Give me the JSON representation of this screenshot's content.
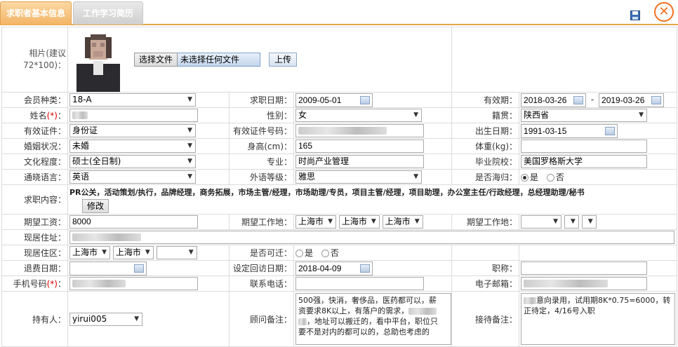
{
  "tabs": {
    "basic": "求职者基本信息",
    "resume": "工作学习简历"
  },
  "toolbar": {
    "close": "✕"
  },
  "photo": {
    "label": "相片(建议72*100)：",
    "choose_file": "选择文件",
    "no_file": "未选择任何文件",
    "upload": "上传"
  },
  "row1": {
    "member_type_label": "会员种类：",
    "member_type": "18-A",
    "job_date_label": "求职日期：",
    "job_date": "2009-05-01",
    "validity_label": "有效期：",
    "validity_from": "2018-03-26",
    "validity_sep": "-",
    "validity_to": "2019-03-26"
  },
  "row2": {
    "name_label": "姓名",
    "name_req": "(*)",
    "name_suffix": "：",
    "gender_label": "性别：",
    "gender": "女",
    "origin_label": "籍贯：",
    "origin": "陕西省"
  },
  "row3": {
    "id_type_label": "有效证件：",
    "id_type": "身份证",
    "id_no_label": "有效证件号码：",
    "birth_label": "出生日期：",
    "birth": "1991-03-15"
  },
  "row4": {
    "marital_label": "婚姻状况：",
    "marital": "未婚",
    "height_label": "身高(cm)：",
    "height": "165",
    "weight_label": "体重(kg)：",
    "weight": ""
  },
  "row5": {
    "edu_label": "文化程度：",
    "edu": "硕士(全日制)",
    "major_label": "专业：",
    "major": "时尚产业管理",
    "school_label": "毕业院校：",
    "school": "美国罗格斯大学"
  },
  "row6": {
    "lang_label": "通晓语言：",
    "lang": "英语",
    "foreign_label": "外语等级：",
    "foreign": "雅思",
    "returnee_label": "是否海归：",
    "yes": "是",
    "no": "否"
  },
  "row7": {
    "content_label": "求职内容：",
    "content": "PR公关，活动策划/执行，品牌经理，商务拓展，市场主管/经理，市场助理/专员，项目主管/经理，项目助理，办公室主任/行政经理，总经理助理/秘书",
    "modify": "修改"
  },
  "row8": {
    "salary_label": "期望工资：",
    "salary": "8000",
    "place_label": "期望工作地：",
    "place1": "上海市",
    "place2": "上海市",
    "place3": "上海市",
    "place2_label": "期望工作地："
  },
  "row9": {
    "address_label": "现居住址："
  },
  "row10": {
    "area_label": "现居住区：",
    "area1": "上海市",
    "area2": "上海市",
    "relocate_label": "是否可迁：",
    "yes": "是",
    "no": "否"
  },
  "row11": {
    "refund_label": "退费日期：",
    "visit_label": "设定回访日期：",
    "visit": "2018-04-09",
    "title_label": "职称："
  },
  "row12": {
    "mobile_label": "手机号码",
    "mobile_req": "(*)",
    "mobile_suffix": "：",
    "phone_label": "联系电话：",
    "email_label": "电子邮箱："
  },
  "row13": {
    "holder_label": "持有人：",
    "holder": "yirui005",
    "consultant_label": "顾问备注：",
    "consultant_l1": "500强，快消，奢侈品，医药都可以，薪",
    "consultant_l2": "资要求8K以上，有落户的需求，",
    "consultant_l3": "，地址可以搬迁的，看中平台，职位只",
    "consultant_l4": "要不是对内的都可以的，总助也考虑的",
    "reception_label": "接待备注：",
    "reception_l1": "意向录用，试用期8K*0.75=6000，转",
    "reception_l2": "正待定，4/16号入职"
  }
}
